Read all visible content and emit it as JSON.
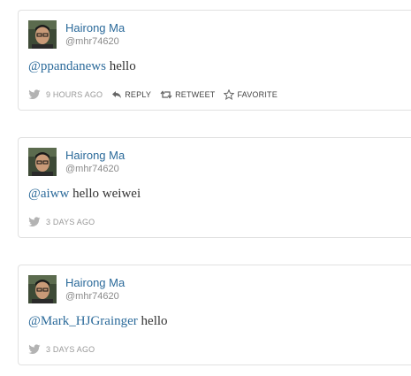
{
  "tweets": [
    {
      "author": "Hairong Ma",
      "handle": "@mhr74620",
      "mention": "@ppandanews",
      "body": " hello",
      "time": "9 HOURS AGO",
      "actions": {
        "reply": "REPLY",
        "retweet": "RETWEET",
        "favorite": "FAVORITE"
      }
    },
    {
      "author": "Hairong Ma",
      "handle": "@mhr74620",
      "mention": "@aiww",
      "body": " hello weiwei",
      "time": "3 DAYS AGO"
    },
    {
      "author": "Hairong Ma",
      "handle": "@mhr74620",
      "mention": "@Mark_HJGrainger",
      "body": " hello",
      "time": "3 DAYS AGO"
    }
  ],
  "colors": {
    "link": "#2b6a9a",
    "muted": "#999999",
    "border": "#e1e1e1"
  }
}
